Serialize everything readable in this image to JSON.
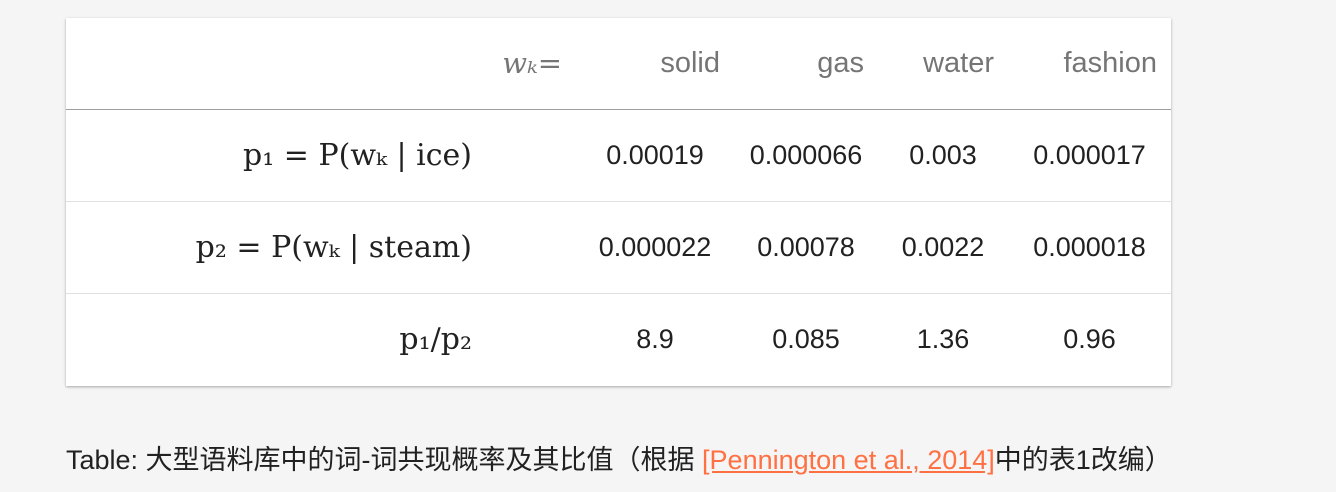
{
  "table": {
    "header": {
      "label": "wₖ=",
      "columns": [
        "solid",
        "gas",
        "water",
        "fashion"
      ]
    },
    "rows": [
      {
        "label": "p₁ = P(wₖ | ice)",
        "values": [
          "0.00019",
          "0.000066",
          "0.003",
          "0.000017"
        ]
      },
      {
        "label": "p₂ = P(wₖ | steam)",
        "values": [
          "0.000022",
          "0.00078",
          "0.0022",
          "0.000018"
        ]
      },
      {
        "label": "p₁/p₂",
        "values": [
          "8.9",
          "0.085",
          "1.36",
          "0.96"
        ]
      }
    ]
  },
  "caption": {
    "prefix": "Table: 大型语料库中的词-词共现概率及其比值（根据 ",
    "link_text": "[Pennington et al., 2014]",
    "suffix": "中的表1改编）"
  },
  "colors": {
    "link": "#ff7043",
    "header_text": "#757575",
    "body_text": "#212121",
    "background": "#f5f5f5"
  }
}
